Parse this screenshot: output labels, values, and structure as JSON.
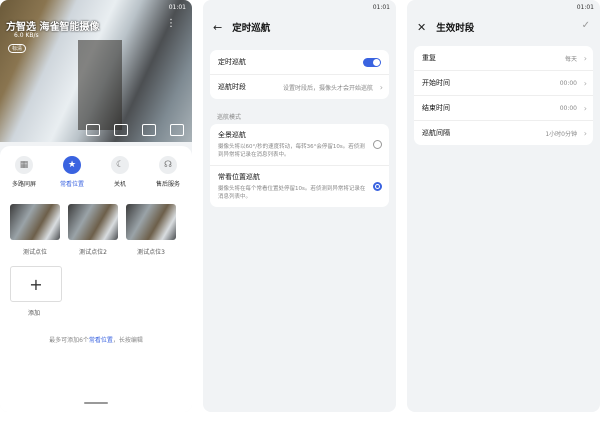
{
  "phone1": {
    "status": "01:01",
    "video_title": "方智选 海雀智能摄像",
    "video_sub": "6.0 KB/s",
    "video_badge": "标清",
    "modes": [
      {
        "label": "多路同屏",
        "icon": "grid-icon"
      },
      {
        "label": "常看位置",
        "icon": "star-icon",
        "active": true
      },
      {
        "label": "关机",
        "icon": "moon-icon"
      },
      {
        "label": "售后服务",
        "icon": "headset-icon"
      }
    ],
    "positions": [
      "测试点位",
      "测试点位2",
      "测试点位3"
    ],
    "add_symbol": "+",
    "add_label": "添加",
    "hint_pre": "最多可添加6个",
    "hint_link": "常看位置",
    "hint_post": "，长按编辑"
  },
  "phone2": {
    "status": "01:01",
    "title": "定时巡航",
    "row_cruise": "定时巡航",
    "row_period": "巡航时段",
    "row_period_value": "设置时段后，摄像头才会开始巡航",
    "section": "巡航模式",
    "opt1_title": "全景巡航",
    "opt1_desc": "摄像头将以60°/秒的速度转动，每转36°会停留10s。若侦测到异常将记录在消息列表中。",
    "opt2_title": "常看位置巡航",
    "opt2_desc": "摄像头将在每个常看位置处停留10s。若侦测到异常将记录在消息列表中。"
  },
  "phone3": {
    "status": "01:01",
    "title": "生效时段",
    "rows": [
      {
        "label": "重复",
        "value": "每天"
      },
      {
        "label": "开始时间",
        "value": "00:00"
      },
      {
        "label": "结束时间",
        "value": "00:00"
      },
      {
        "label": "巡航间隔",
        "value": "1小时0分钟"
      }
    ]
  }
}
